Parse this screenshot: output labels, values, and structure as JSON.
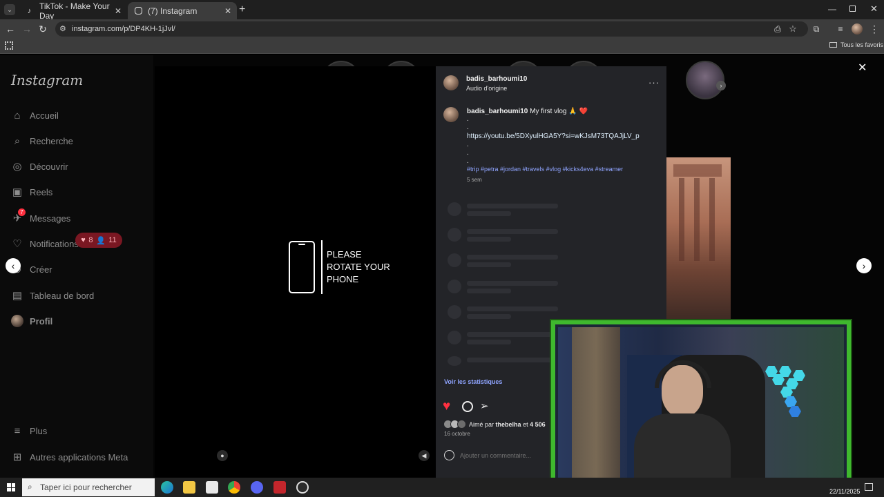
{
  "browser": {
    "tabs": [
      {
        "label": "TikTok - Make Your Day",
        "active": false
      },
      {
        "label": "(7) Instagram",
        "active": true
      }
    ],
    "url": "instagram.com/p/DP4KH-1jJvl/",
    "bookmarks_label": "Tous les favoris"
  },
  "sidebar": {
    "logo": "Instagram",
    "items": [
      {
        "label": "Accueil",
        "icon": "home-icon"
      },
      {
        "label": "Recherche",
        "icon": "search-icon"
      },
      {
        "label": "Découvrir",
        "icon": "compass-icon"
      },
      {
        "label": "Reels",
        "icon": "reels-icon"
      },
      {
        "label": "Messages",
        "icon": "messenger-icon",
        "badge": "7"
      },
      {
        "label": "Notifications",
        "icon": "heart-icon"
      },
      {
        "label": "Créer",
        "icon": "plus-icon"
      },
      {
        "label": "Tableau de bord",
        "icon": "dashboard-icon"
      },
      {
        "label": "Profil",
        "icon": "avatar-icon"
      }
    ],
    "more": {
      "label": "Plus"
    },
    "meta_apps": {
      "label": "Autres applications Meta"
    },
    "notif_pill": {
      "likes": "8",
      "follows": "11"
    }
  },
  "video": {
    "rotate_text": "PLEASE ROTATE YOUR PHONE"
  },
  "post": {
    "username": "badis_barhoumi10",
    "audio": "Audio d'origine",
    "caption_user": "badis_barhoumi10",
    "caption_text": "My first vlog 🙏 ❤️",
    "dot1": ".",
    "dot2": ".",
    "link": "https://youtu.be/5DXyulHGA5Y?si=wKJsM73TQAJjLV_p",
    "dot3": ".",
    "dot4": ".",
    "dot5": ".",
    "hashtags": "#trip #petra #jordan #travels #vlog #kicks4eva #streamer",
    "age": "5 sem",
    "stats_link": "Voir les statistiques",
    "liked_prefix": "Aimé par",
    "liked_user": "thebelha",
    "liked_and": "et",
    "liked_count": "4 506",
    "date": "16 octobre",
    "comment_placeholder": "Ajouter un commentaire..."
  },
  "taskbar": {
    "search_placeholder": "Taper ici pour rechercher",
    "date": "22/11/2025"
  },
  "colors": {
    "accent_link": "#e0f1ff",
    "hashtag": "#8fa4ff",
    "stats": "#8fa4ff",
    "heart": "#ff3040",
    "badge": "#ff3040",
    "webcam_border": "#3fb82e"
  }
}
